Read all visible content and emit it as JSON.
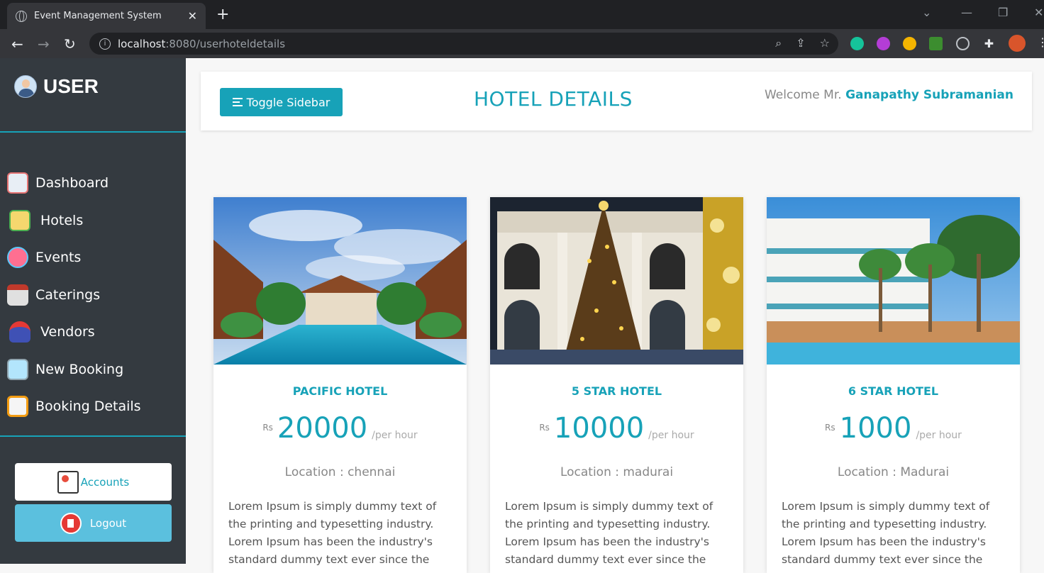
{
  "browser": {
    "tab_title": "Event Management System",
    "url_host": "localhost",
    "url_path": ":8080/userhoteldetails"
  },
  "sidebar": {
    "brand": "USER",
    "items": [
      {
        "label": "Dashboard",
        "icon": "dashboard-icon"
      },
      {
        "label": "Hotels",
        "icon": "hotels-icon"
      },
      {
        "label": "Events",
        "icon": "events-icon"
      },
      {
        "label": "Caterings",
        "icon": "caterings-icon"
      },
      {
        "label": "Vendors",
        "icon": "vendors-icon"
      },
      {
        "label": "New Booking",
        "icon": "new-booking-icon"
      },
      {
        "label": "Booking Details",
        "icon": "booking-details-icon"
      }
    ],
    "accounts_label": "Accounts",
    "logout_label": "Logout"
  },
  "header": {
    "toggle_label": "Toggle Sidebar",
    "title": "HOTEL DETAILS",
    "welcome_prefix": "Welcome Mr.",
    "user_name": "Ganapathy Subramanian"
  },
  "hotels": [
    {
      "name": "PACIFIC HOTEL",
      "currency": "Rs",
      "price": "20000",
      "unit": "/per hour",
      "location": "Location : chennai",
      "description": "Lorem Ipsum is simply dummy text of the printing and typesetting industry. Lorem Ipsum has been the industry's standard dummy text ever since the"
    },
    {
      "name": "5 STAR HOTEL",
      "currency": "Rs",
      "price": "10000",
      "unit": "/per hour",
      "location": "Location : madurai",
      "description": "Lorem Ipsum is simply dummy text of the printing and typesetting industry. Lorem Ipsum has been the industry's standard dummy text ever since the"
    },
    {
      "name": "6 STAR HOTEL",
      "currency": "Rs",
      "price": "1000",
      "unit": "/per hour",
      "location": "Location : Madurai",
      "description": "Lorem Ipsum is simply dummy text of the printing and typesetting industry. Lorem Ipsum has been the industry's standard dummy text ever since the"
    }
  ],
  "colors": {
    "accent": "#17a2b8",
    "sidebar_bg": "#343a40",
    "logout_bg": "#5bc0de"
  }
}
